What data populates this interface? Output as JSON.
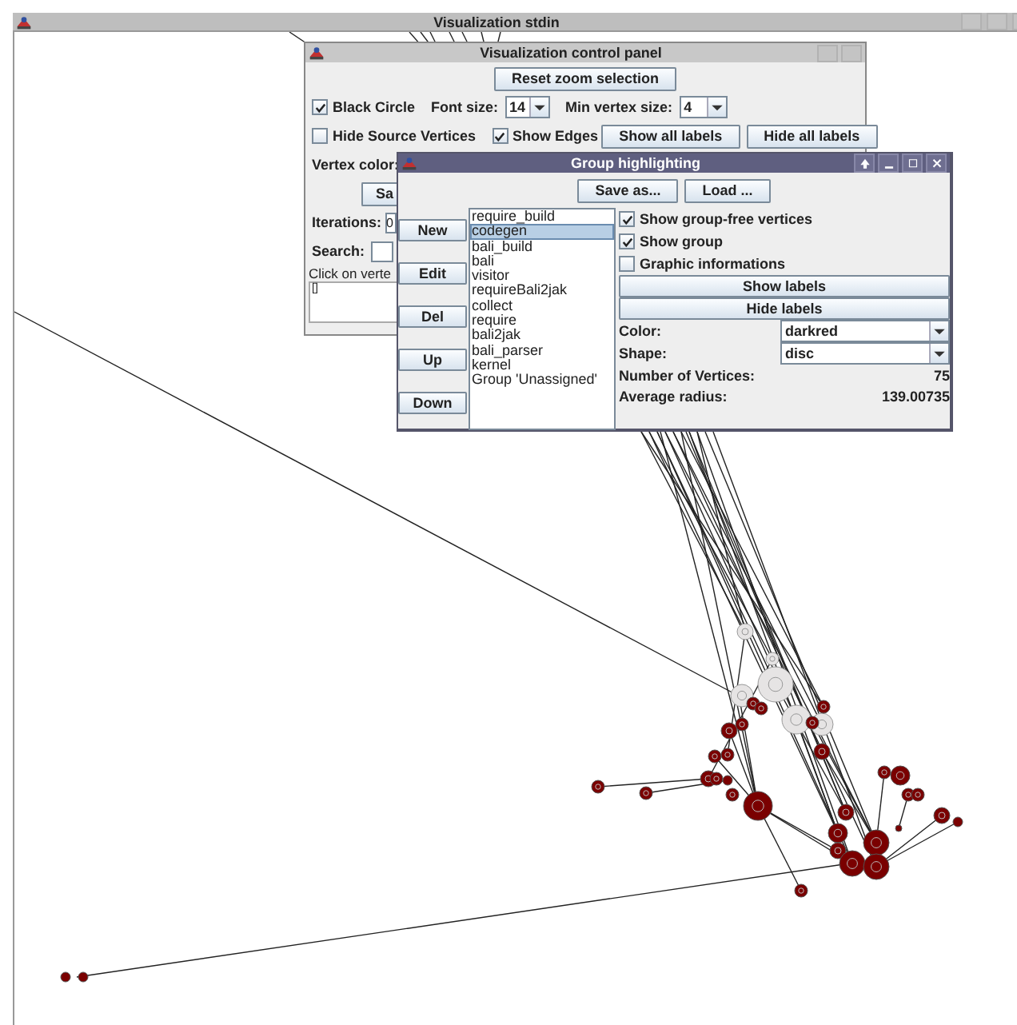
{
  "main_window": {
    "title": "Visualization stdin"
  },
  "control_panel": {
    "title": "Visualization control panel",
    "reset_button": "Reset zoom selection",
    "black_circle": {
      "label": "Black Circle",
      "checked": true
    },
    "font_size": {
      "label": "Font size:",
      "value": "14"
    },
    "min_vertex_size": {
      "label": "Min vertex size:",
      "value": "4"
    },
    "hide_source_vertices": {
      "label": "Hide Source Vertices",
      "checked": false
    },
    "show_edges": {
      "label": "Show Edges",
      "checked": true
    },
    "show_all_labels": "Show all labels",
    "hide_all_labels": "Hide all labels",
    "vertex_color_label": "Vertex color:",
    "save_button": "Sa",
    "iterations_label": "Iterations:",
    "iterations_value": "0",
    "search_label": "Search:",
    "click_hint": "Click on verte",
    "output": "[]"
  },
  "group_window": {
    "title": "Group highlighting",
    "save_as": "Save as...",
    "load": "Load ...",
    "side_buttons": [
      "New",
      "Edit",
      "Del",
      "Up",
      "Down"
    ],
    "groups": [
      {
        "label": "require_build",
        "selected": false
      },
      {
        "label": "codegen",
        "selected": true
      },
      {
        "label": "bali_build",
        "selected": false
      },
      {
        "label": "bali",
        "selected": false
      },
      {
        "label": "visitor",
        "selected": false
      },
      {
        "label": "requireBali2jak",
        "selected": false
      },
      {
        "label": "collect",
        "selected": false
      },
      {
        "label": "require",
        "selected": false
      },
      {
        "label": "bali2jak",
        "selected": false
      },
      {
        "label": "bali_parser",
        "selected": false
      },
      {
        "label": "kernel",
        "selected": false
      },
      {
        "label": "Group 'Unassigned'",
        "selected": false
      }
    ],
    "options": [
      {
        "label": "Show group-free vertices",
        "checked": true
      },
      {
        "label": "Show group",
        "checked": true
      },
      {
        "label": "Graphic informations",
        "checked": false
      }
    ],
    "show_labels": "Show labels",
    "hide_labels": "Hide labels",
    "color": {
      "label": "Color:",
      "value": "darkred"
    },
    "shape": {
      "label": "Shape:",
      "value": "disc"
    },
    "number_of_vertices": {
      "label": "Number of Vertices:",
      "value": "75"
    },
    "average_radius": {
      "label": "Average radius:",
      "value": "139.00735"
    }
  }
}
